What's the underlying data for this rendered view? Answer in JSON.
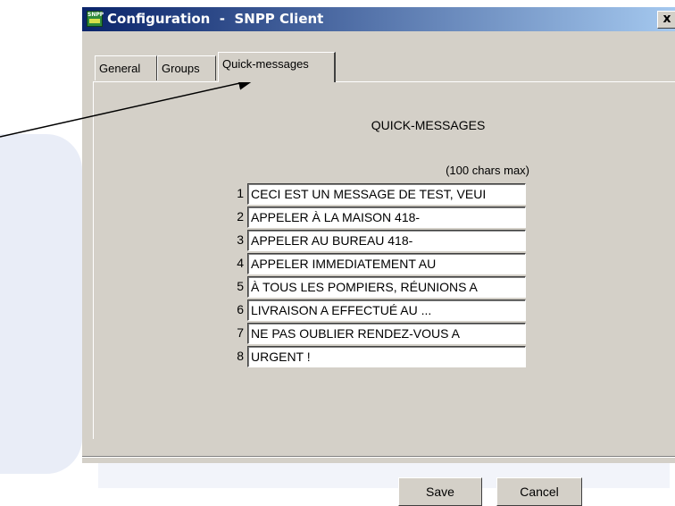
{
  "window": {
    "title": "Configuration  -  SNPP Client",
    "app_icon_text": "SNPP",
    "close_label": "x"
  },
  "tabs": [
    {
      "label": "General",
      "active": false
    },
    {
      "label": "Groups",
      "active": false
    },
    {
      "label": "Quick-messages",
      "active": true
    }
  ],
  "quick_messages": {
    "heading": "QUICK-MESSAGES",
    "limit_note": "(100 chars max)",
    "items": [
      {
        "number": "1",
        "value": "CECI EST UN MESSAGE DE TEST, VEUI"
      },
      {
        "number": "2",
        "value": "APPELER À LA MAISON  418-"
      },
      {
        "number": "3",
        "value": "APPELER AU BUREAU  418-"
      },
      {
        "number": "4",
        "value": "APPELER IMMEDIATEMENT AU"
      },
      {
        "number": "5",
        "value": "À TOUS LES POMPIERS, RÉUNIONS A"
      },
      {
        "number": "6",
        "value": "LIVRAISON A EFFECTUÉ AU ..."
      },
      {
        "number": "7",
        "value": "NE PAS OUBLIER RENDEZ-VOUS A"
      },
      {
        "number": "8",
        "value": "URGENT !"
      }
    ]
  },
  "buttons": {
    "save": "Save",
    "cancel": "Cancel"
  }
}
